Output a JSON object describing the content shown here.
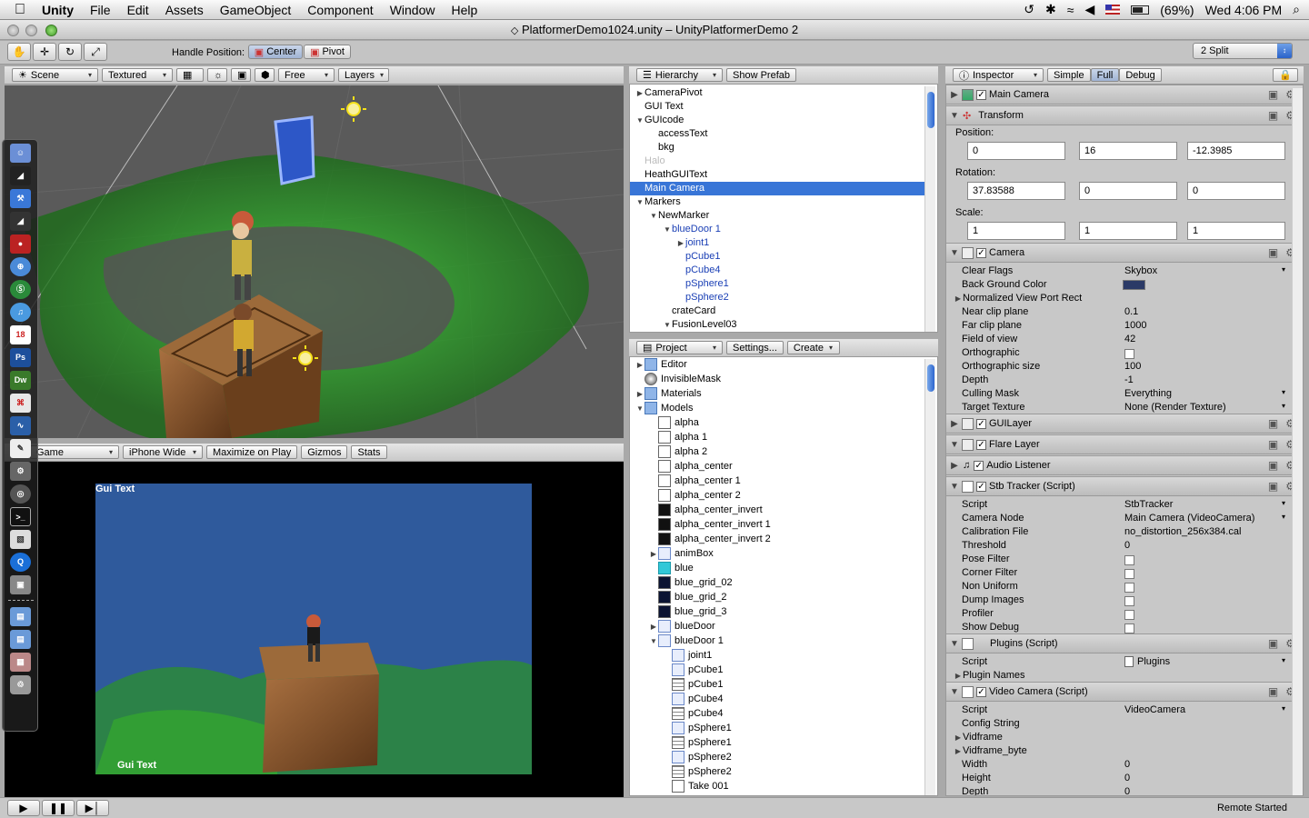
{
  "menubar": {
    "apple": "",
    "items": [
      "Unity",
      "File",
      "Edit",
      "Assets",
      "GameObject",
      "Component",
      "Window",
      "Help"
    ],
    "battery": "(69%)",
    "clock": "Wed 4:06 PM"
  },
  "window": {
    "title": "PlatformerDemo1024.unity – UnityPlatformerDemo 2"
  },
  "toolbar": {
    "handle_label": "Handle Position:",
    "center": "Center",
    "pivot": "Pivot",
    "layout": "2 Split"
  },
  "scene": {
    "tab": "Scene",
    "render_mode": "Textured",
    "camera_mode": "Free",
    "layers": "Layers"
  },
  "game": {
    "tab": "Game",
    "aspect": "iPhone Wide",
    "maximize": "Maximize on Play",
    "gizmos": "Gizmos",
    "stats": "Stats",
    "gui_text_top": "Gui Text",
    "gui_text_bottom": "Gui Text"
  },
  "hierarchy": {
    "tab": "Hierarchy",
    "show_prefab": "Show Prefab",
    "items": [
      {
        "label": "CameraPivot",
        "indent": 0,
        "tri": "▶",
        "style": ""
      },
      {
        "label": "GUI Text",
        "indent": 0,
        "tri": "",
        "style": ""
      },
      {
        "label": "GUIcode",
        "indent": 0,
        "tri": "▼",
        "style": ""
      },
      {
        "label": "accessText",
        "indent": 1,
        "tri": "",
        "style": ""
      },
      {
        "label": "bkg",
        "indent": 1,
        "tri": "",
        "style": ""
      },
      {
        "label": "Halo",
        "indent": 0,
        "tri": "",
        "style": "gray"
      },
      {
        "label": "HeathGUIText",
        "indent": 0,
        "tri": "",
        "style": ""
      },
      {
        "label": "Main Camera",
        "indent": 0,
        "tri": "",
        "style": "sel"
      },
      {
        "label": "Markers",
        "indent": 0,
        "tri": "▼",
        "style": ""
      },
      {
        "label": "NewMarker",
        "indent": 1,
        "tri": "▼",
        "style": ""
      },
      {
        "label": "blueDoor 1",
        "indent": 2,
        "tri": "▼",
        "style": "blue"
      },
      {
        "label": "joint1",
        "indent": 3,
        "tri": "▶",
        "style": "blue"
      },
      {
        "label": "pCube1",
        "indent": 3,
        "tri": "",
        "style": "blue"
      },
      {
        "label": "pCube4",
        "indent": 3,
        "tri": "",
        "style": "blue"
      },
      {
        "label": "pSphere1",
        "indent": 3,
        "tri": "",
        "style": "blue"
      },
      {
        "label": "pSphere2",
        "indent": 3,
        "tri": "",
        "style": "blue"
      },
      {
        "label": "crateCard",
        "indent": 2,
        "tri": "",
        "style": ""
      },
      {
        "label": "FusionLevel03",
        "indent": 2,
        "tri": "▼",
        "style": ""
      }
    ]
  },
  "project": {
    "tab": "Project",
    "settings": "Settings...",
    "create": "Create",
    "items": [
      {
        "label": "Editor",
        "indent": 0,
        "tri": "▶",
        "icon": "folder"
      },
      {
        "label": "InvisibleMask",
        "indent": 0,
        "tri": "",
        "icon": "sphere"
      },
      {
        "label": "Materials",
        "indent": 0,
        "tri": "▶",
        "icon": "folder"
      },
      {
        "label": "Models",
        "indent": 0,
        "tri": "▼",
        "icon": "folder"
      },
      {
        "label": "alpha",
        "indent": 1,
        "tri": "",
        "icon": "white"
      },
      {
        "label": "alpha 1",
        "indent": 1,
        "tri": "",
        "icon": "white"
      },
      {
        "label": "alpha 2",
        "indent": 1,
        "tri": "",
        "icon": "white"
      },
      {
        "label": "alpha_center",
        "indent": 1,
        "tri": "",
        "icon": "white"
      },
      {
        "label": "alpha_center 1",
        "indent": 1,
        "tri": "",
        "icon": "white"
      },
      {
        "label": "alpha_center 2",
        "indent": 1,
        "tri": "",
        "icon": "white"
      },
      {
        "label": "alpha_center_invert",
        "indent": 1,
        "tri": "",
        "icon": "black"
      },
      {
        "label": "alpha_center_invert 1",
        "indent": 1,
        "tri": "",
        "icon": "black"
      },
      {
        "label": "alpha_center_invert 2",
        "indent": 1,
        "tri": "",
        "icon": "black"
      },
      {
        "label": "animBox",
        "indent": 1,
        "tri": "▶",
        "icon": "prefab"
      },
      {
        "label": "blue",
        "indent": 1,
        "tri": "",
        "icon": "cyan"
      },
      {
        "label": "blue_grid_02",
        "indent": 1,
        "tri": "",
        "icon": "navy"
      },
      {
        "label": "blue_grid_2",
        "indent": 1,
        "tri": "",
        "icon": "navy"
      },
      {
        "label": "blue_grid_3",
        "indent": 1,
        "tri": "",
        "icon": "navy"
      },
      {
        "label": "blueDoor",
        "indent": 1,
        "tri": "▶",
        "icon": "prefab"
      },
      {
        "label": "blueDoor 1",
        "indent": 1,
        "tri": "▼",
        "icon": "prefab"
      },
      {
        "label": "joint1",
        "indent": 2,
        "tri": "",
        "icon": "prefab"
      },
      {
        "label": "pCube1",
        "indent": 2,
        "tri": "",
        "icon": "prefab"
      },
      {
        "label": "pCube1",
        "indent": 2,
        "tri": "",
        "icon": "grid"
      },
      {
        "label": "pCube4",
        "indent": 2,
        "tri": "",
        "icon": "prefab"
      },
      {
        "label": "pCube4",
        "indent": 2,
        "tri": "",
        "icon": "grid"
      },
      {
        "label": "pSphere1",
        "indent": 2,
        "tri": "",
        "icon": "prefab"
      },
      {
        "label": "pSphere1",
        "indent": 2,
        "tri": "",
        "icon": "grid"
      },
      {
        "label": "pSphere2",
        "indent": 2,
        "tri": "",
        "icon": "prefab"
      },
      {
        "label": "pSphere2",
        "indent": 2,
        "tri": "",
        "icon": "grid"
      },
      {
        "label": "Take 001",
        "indent": 2,
        "tri": "",
        "icon": "white"
      }
    ]
  },
  "inspector": {
    "tab": "Inspector",
    "simple": "Simple",
    "full": "Full",
    "debug": "Debug",
    "object_name": "Main Camera",
    "transform": {
      "title": "Transform",
      "position_label": "Position:",
      "position": [
        "0",
        "16",
        "-12.3985"
      ],
      "rotation_label": "Rotation:",
      "rotation": [
        "37.83588",
        "0",
        "0"
      ],
      "scale_label": "Scale:",
      "scale": [
        "1",
        "1",
        "1"
      ]
    },
    "camera": {
      "title": "Camera",
      "props": [
        {
          "k": "Clear Flags",
          "v": "Skybox",
          "tri": ""
        },
        {
          "k": "Back Ground Color",
          "v": "",
          "tri": ""
        },
        {
          "k": "Normalized View Port Rect",
          "v": "",
          "tri": "▶"
        },
        {
          "k": "Near clip plane",
          "v": "0.1",
          "tri": ""
        },
        {
          "k": "Far clip plane",
          "v": "1000",
          "tri": ""
        },
        {
          "k": "Field of view",
          "v": "42",
          "tri": ""
        },
        {
          "k": "Orthographic",
          "v": "",
          "tri": ""
        },
        {
          "k": "Orthographic size",
          "v": "100",
          "tri": ""
        },
        {
          "k": "Depth",
          "v": "-1",
          "tri": ""
        },
        {
          "k": "Culling Mask",
          "v": "Everything",
          "tri": ""
        },
        {
          "k": "Target Texture",
          "v": "None (Render Texture)",
          "tri": ""
        }
      ],
      "bg_color": "#2b3a66"
    },
    "guilayer": "GUILayer",
    "flarelayer": "Flare Layer",
    "audiolistener": "Audio Listener",
    "stbtracker": {
      "title": "Stb Tracker (Script)",
      "props": [
        {
          "k": "Script",
          "v": "StbTracker"
        },
        {
          "k": "Camera Node",
          "v": "Main Camera (VideoCamera)"
        },
        {
          "k": "Calibration File",
          "v": "no_distortion_256x384.cal"
        },
        {
          "k": "Threshold",
          "v": "0"
        },
        {
          "k": "Pose Filter",
          "v": ""
        },
        {
          "k": "Corner Filter",
          "v": ""
        },
        {
          "k": "Non Uniform",
          "v": ""
        },
        {
          "k": "Dump Images",
          "v": ""
        },
        {
          "k": "Profiler",
          "v": ""
        },
        {
          "k": "Show Debug",
          "v": ""
        }
      ]
    },
    "plugins": {
      "title": "Plugins (Script)",
      "script_label": "Script",
      "script_value": "Plugins",
      "names_label": "Plugin Names"
    },
    "videocamera": {
      "title": "Video Camera (Script)",
      "props": [
        {
          "k": "Script",
          "v": "VideoCamera",
          "tri": ""
        },
        {
          "k": "Config String",
          "v": "",
          "tri": ""
        },
        {
          "k": "Vidframe",
          "v": "",
          "tri": "▶"
        },
        {
          "k": "Vidframe_byte",
          "v": "",
          "tri": "▶"
        },
        {
          "k": "Width",
          "v": "0",
          "tri": ""
        },
        {
          "k": "Height",
          "v": "0",
          "tri": ""
        },
        {
          "k": "Depth",
          "v": "0",
          "tri": ""
        }
      ]
    }
  },
  "status": {
    "text": "Remote Started"
  },
  "dock": {
    "ps": "Ps",
    "dw": "Dw",
    "cal": "18"
  }
}
